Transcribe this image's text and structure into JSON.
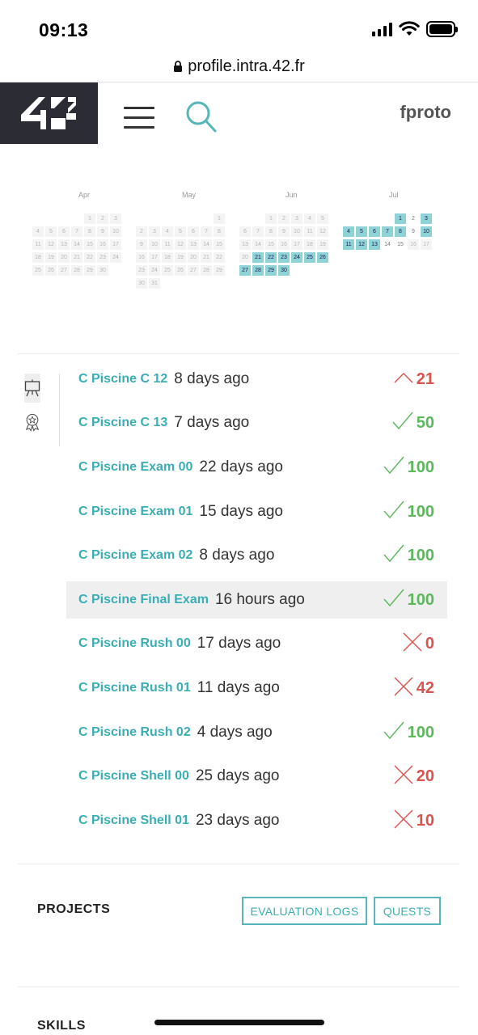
{
  "status_bar": {
    "time": "09:13"
  },
  "browser": {
    "url": "profile.intra.42.fr"
  },
  "header": {
    "user": "fproto"
  },
  "calendar": {
    "months": [
      {
        "name": "Apr",
        "weeks": [
          [
            "",
            "",
            "",
            "",
            "1",
            "2",
            "3"
          ],
          [
            "4",
            "5",
            "6",
            "7",
            "8",
            "9",
            "10"
          ],
          [
            "11",
            "12",
            "13",
            "14",
            "15",
            "16",
            "17"
          ],
          [
            "18",
            "19",
            "20",
            "21",
            "22",
            "23",
            "24"
          ],
          [
            "25",
            "26",
            "27",
            "28",
            "29",
            "30",
            ""
          ]
        ]
      },
      {
        "name": "May",
        "weeks": [
          [
            "",
            "",
            "",
            "",
            "",
            "",
            "1"
          ],
          [
            "2",
            "3",
            "4",
            "5",
            "6",
            "7",
            "8"
          ],
          [
            "9",
            "10",
            "11",
            "12",
            "13",
            "14",
            "15"
          ],
          [
            "16",
            "17",
            "18",
            "19",
            "20",
            "21",
            "22"
          ],
          [
            "23",
            "24",
            "25",
            "26",
            "27",
            "28",
            "29"
          ],
          [
            "30",
            "31",
            "",
            "",
            "",
            "",
            ""
          ]
        ]
      },
      {
        "name": "Jun",
        "weeks": [
          [
            "",
            "",
            "1",
            "2",
            "3",
            "4",
            "5"
          ],
          [
            "6",
            "7",
            "8",
            "9",
            "10",
            "11",
            "12"
          ],
          [
            "13",
            "14",
            "15",
            "16",
            "17",
            "18",
            "19"
          ],
          [
            "20",
            "21",
            "22",
            "23",
            "24",
            "25",
            "26"
          ],
          [
            "27",
            "28",
            "29",
            "30",
            "",
            "",
            ""
          ]
        ]
      },
      {
        "name": "Jul",
        "weeks": [
          [
            "",
            "",
            "",
            "",
            "1",
            "2",
            "3"
          ],
          [
            "4",
            "5",
            "6",
            "7",
            "8",
            "9",
            "10"
          ],
          [
            "11",
            "12",
            "13",
            "14",
            "15",
            "16",
            "17"
          ]
        ]
      }
    ],
    "active_days": {
      "Jun": [
        "21",
        "22",
        "23",
        "24",
        "25",
        "26",
        "27",
        "28",
        "29",
        "30"
      ],
      "Jul": [
        "1",
        "3",
        "4",
        "5",
        "6",
        "7",
        "8",
        "10",
        "11",
        "12",
        "13"
      ]
    },
    "plain_days": {
      "Jul": [
        "2",
        "9",
        "14",
        "15"
      ]
    },
    "colors": {
      "active": "#8fd3d6",
      "inactive": "#f4f4f4"
    }
  },
  "projects": [
    {
      "name": "C Piscine C 12",
      "time": "8 days ago",
      "status": "pending",
      "grade": "21"
    },
    {
      "name": "C Piscine C 13",
      "time": "7 days ago",
      "status": "ok",
      "grade": "50"
    },
    {
      "name": "C Piscine Exam 00",
      "time": "22 days ago",
      "status": "ok",
      "grade": "100"
    },
    {
      "name": "C Piscine Exam 01",
      "time": "15 days ago",
      "status": "ok",
      "grade": "100"
    },
    {
      "name": "C Piscine Exam 02",
      "time": "8 days ago",
      "status": "ok",
      "grade": "100"
    },
    {
      "name": "C Piscine Final Exam",
      "time": "16 hours ago",
      "status": "ok",
      "grade": "100",
      "highlighted": true
    },
    {
      "name": "C Piscine Rush 00",
      "time": "17 days ago",
      "status": "ko",
      "grade": "0"
    },
    {
      "name": "C Piscine Rush 01",
      "time": "11 days ago",
      "status": "ko",
      "grade": "42"
    },
    {
      "name": "C Piscine Rush 02",
      "time": "4 days ago",
      "status": "ok",
      "grade": "100"
    },
    {
      "name": "C Piscine Shell 00",
      "time": "25 days ago",
      "status": "ko",
      "grade": "20"
    },
    {
      "name": "C Piscine Shell 01",
      "time": "23 days ago",
      "status": "ko",
      "grade": "10"
    }
  ],
  "sections": {
    "projects_title": "PROJECTS",
    "evaluation_logs": "EVALUATION LOGS",
    "quests": "QUESTS",
    "skills_title": "SKILLS"
  },
  "colors": {
    "accent": "#3aaeb4",
    "success": "#5cb85c",
    "fail": "#d9534f"
  }
}
